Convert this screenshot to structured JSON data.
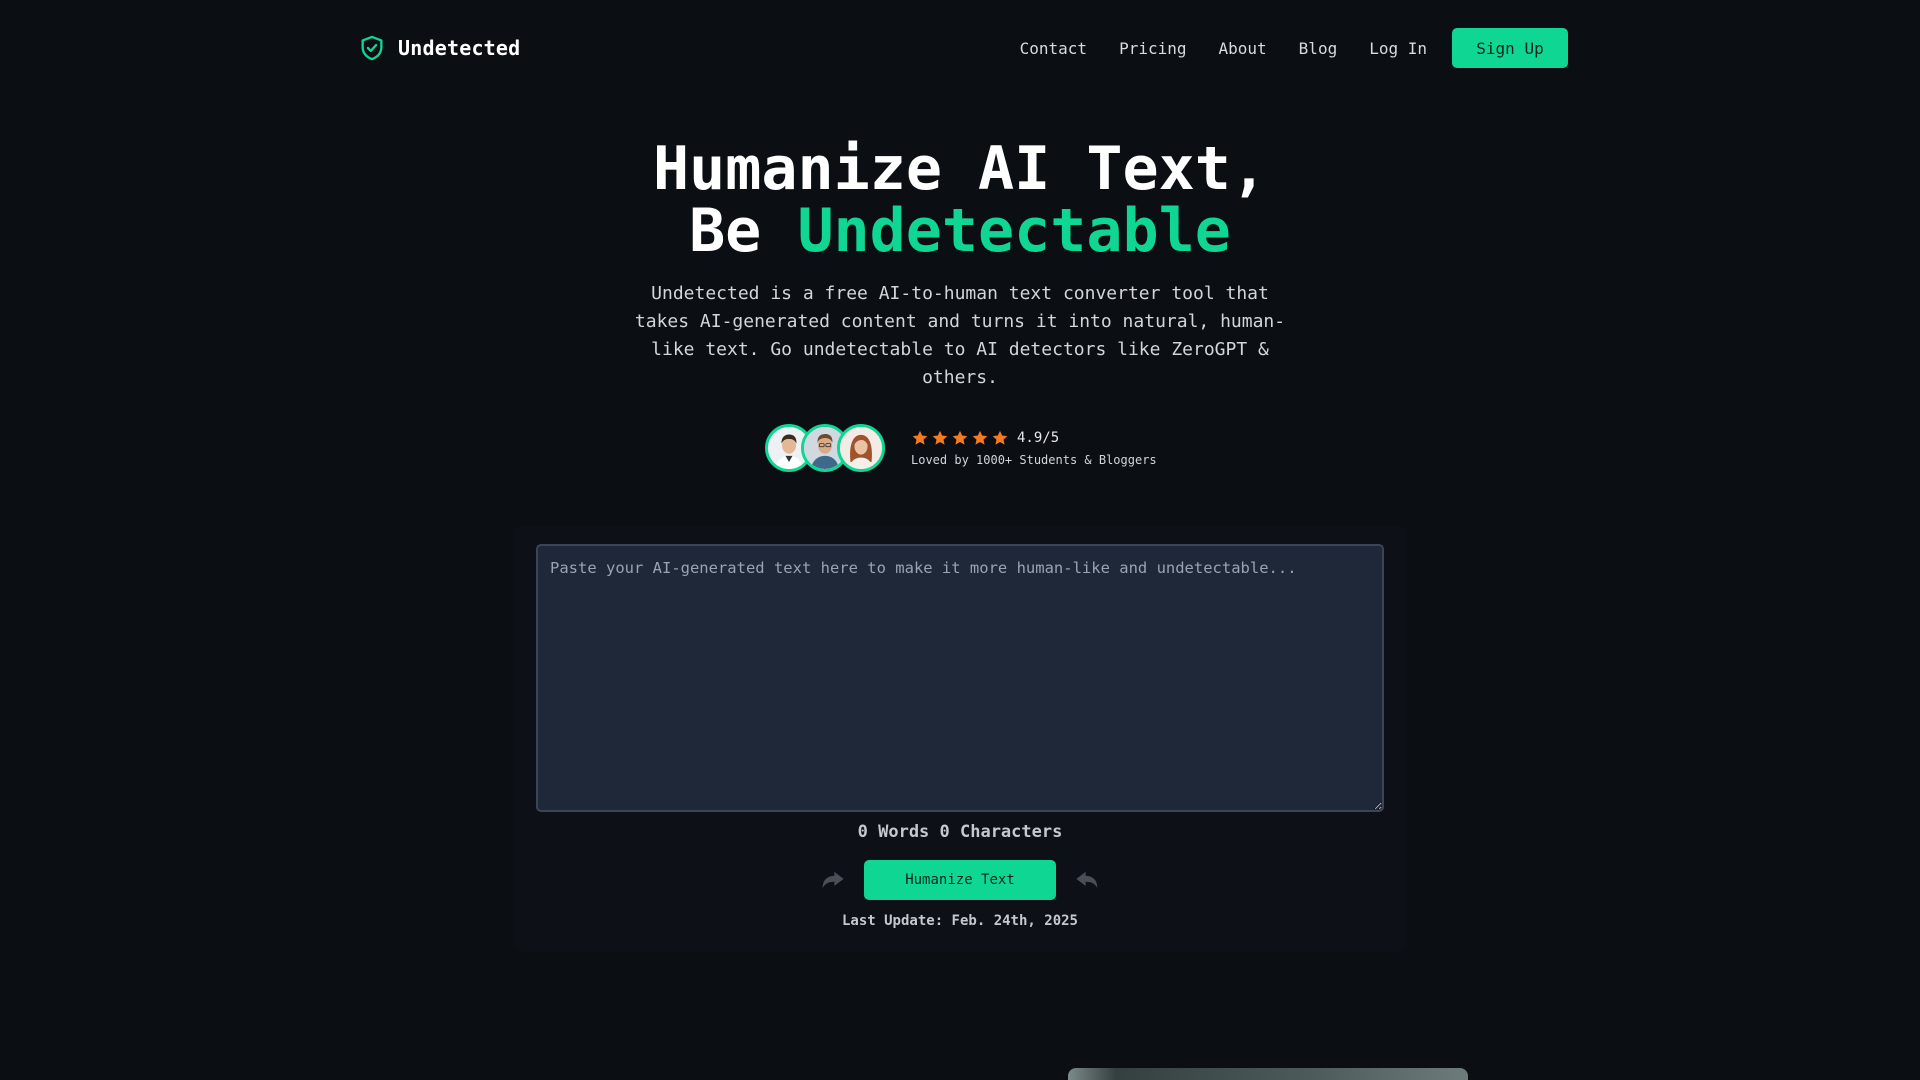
{
  "brand": {
    "name": "Undetected"
  },
  "nav": {
    "links": [
      "Contact",
      "Pricing",
      "About",
      "Blog",
      "Log In"
    ],
    "signup_label": "Sign Up"
  },
  "hero": {
    "title_line1": "Humanize AI Text,",
    "title_line2_prefix": "Be ",
    "title_line2_accent": "Undetectable",
    "subtitle": "Undetected is a free AI-to-human text converter tool that takes AI-generated content and turns it into natural, human-like text. Go undetectable to AI detectors like ZeroGPT & others."
  },
  "social_proof": {
    "rating": "4.9/5",
    "stars": 5,
    "loved_text": "Loved by 1000+ Students & Bloggers"
  },
  "editor": {
    "placeholder": "Paste your AI-generated text here to make it more human-like and undetectable...",
    "value": "",
    "counts": "0 Words 0 Characters",
    "humanize_label": "Humanize Text",
    "last_update": "Last Update: Feb. 24th, 2025"
  },
  "colors": {
    "accent": "#10d693",
    "background": "#0b0e13",
    "textarea_bg": "#1f2838",
    "star": "#f47b20"
  },
  "icons": {
    "brand": "shield-check-icon",
    "star": "star-icon",
    "left_arrow": "curved-arrow-right-icon",
    "right_arrow": "curved-arrow-left-icon"
  }
}
